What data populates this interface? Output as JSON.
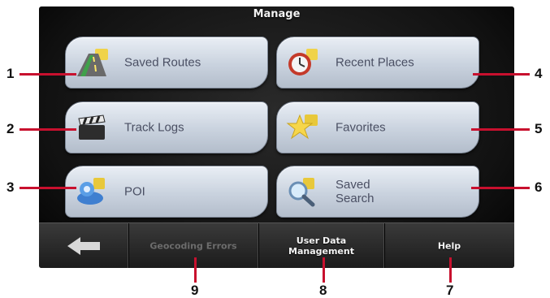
{
  "screen": {
    "title": "Manage",
    "tiles": [
      {
        "label": "Saved Routes",
        "icon": "road-icon"
      },
      {
        "label": "Recent Places",
        "icon": "clock-icon"
      },
      {
        "label": "Track Logs",
        "icon": "clapperboard-icon"
      },
      {
        "label": "Favorites",
        "icon": "star-icon"
      },
      {
        "label": "POI",
        "icon": "poi-icon"
      },
      {
        "label": "Saved\nSearch",
        "icon": "magnifier-icon"
      }
    ],
    "bottom_bar": {
      "back_icon": "back-arrow-icon",
      "geocoding_errors": "Geocoding Errors",
      "user_data_management": "User Data\nManagement",
      "help": "Help"
    }
  },
  "callouts": [
    "1",
    "2",
    "3",
    "4",
    "5",
    "6",
    "7",
    "8",
    "9"
  ],
  "colors": {
    "callout_line": "#c8102e",
    "tile_text": "#4a4f63"
  }
}
